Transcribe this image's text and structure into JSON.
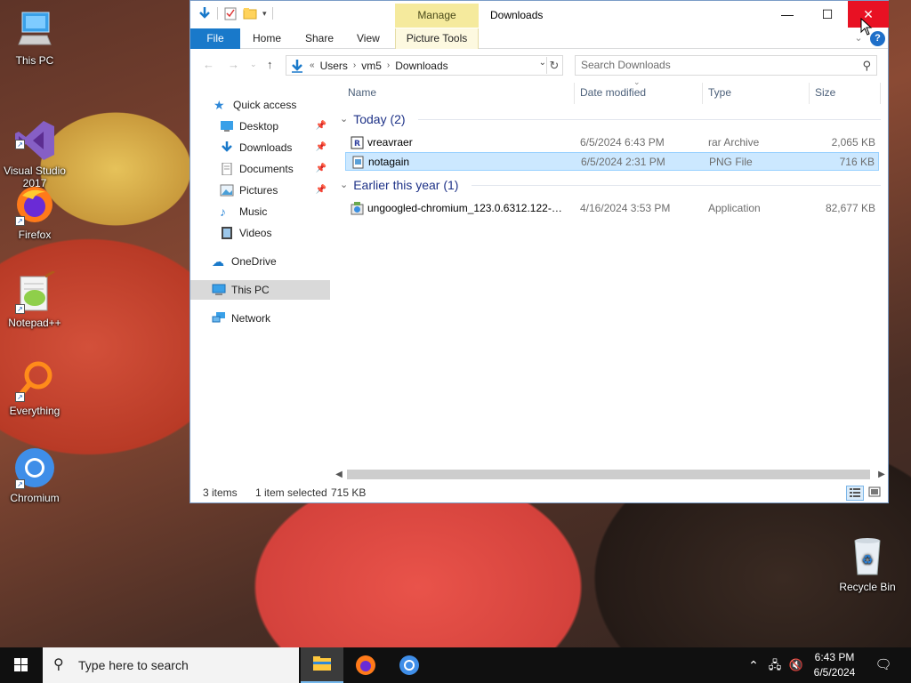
{
  "desktop": {
    "icons": [
      {
        "label": "This PC",
        "icon": "computer-icon"
      },
      {
        "label": "Visual Studio\n2017",
        "icon": "visual-studio-icon"
      },
      {
        "label": "Firefox",
        "icon": "firefox-icon"
      },
      {
        "label": "Notepad++",
        "icon": "notepad-plus-plus-icon"
      },
      {
        "label": "Everything",
        "icon": "everything-search-icon"
      },
      {
        "label": "Chromium",
        "icon": "chromium-icon"
      },
      {
        "label": "Recycle Bin",
        "icon": "recycle-bin-icon"
      }
    ]
  },
  "window": {
    "title": "Downloads",
    "context_tab": "Manage",
    "ribbon_tabs": [
      "File",
      "Home",
      "Share",
      "View",
      "Picture Tools"
    ],
    "accent": "#1979ca",
    "close_color": "#e81123"
  },
  "address": {
    "prefix": "«",
    "crumbs": [
      "Users",
      "vm5",
      "Downloads"
    ]
  },
  "search": {
    "placeholder": "Search Downloads"
  },
  "nav": {
    "quick_access": "Quick access",
    "items": [
      "Desktop",
      "Downloads",
      "Documents",
      "Pictures",
      "Music",
      "Videos"
    ],
    "onedrive": "OneDrive",
    "this_pc": "This PC",
    "network": "Network"
  },
  "columns": {
    "name": "Name",
    "date": "Date modified",
    "type": "Type",
    "size": "Size"
  },
  "groups": [
    {
      "label": "Today (2)",
      "files": [
        {
          "name": "vreavraer",
          "date": "6/5/2024 6:43 PM",
          "type": "rar Archive",
          "size": "2,065 KB",
          "icon": "rar-archive-icon"
        },
        {
          "name": "notagain",
          "date": "6/5/2024 2:31 PM",
          "type": "PNG File",
          "size": "716 KB",
          "icon": "png-file-icon",
          "selected": true
        }
      ]
    },
    {
      "label": "Earlier this year (1)",
      "files": [
        {
          "name": "ungoogled-chromium_123.0.6312.122-1....",
          "date": "4/16/2024 3:53 PM",
          "type": "Application",
          "size": "82,677 KB",
          "icon": "installer-icon"
        }
      ]
    }
  ],
  "status": {
    "count": "3 items",
    "selection": "1 item selected",
    "size": "715 KB"
  },
  "taskbar": {
    "search_placeholder": "Type here to search",
    "time": "6:43 PM",
    "date": "6/5/2024"
  }
}
